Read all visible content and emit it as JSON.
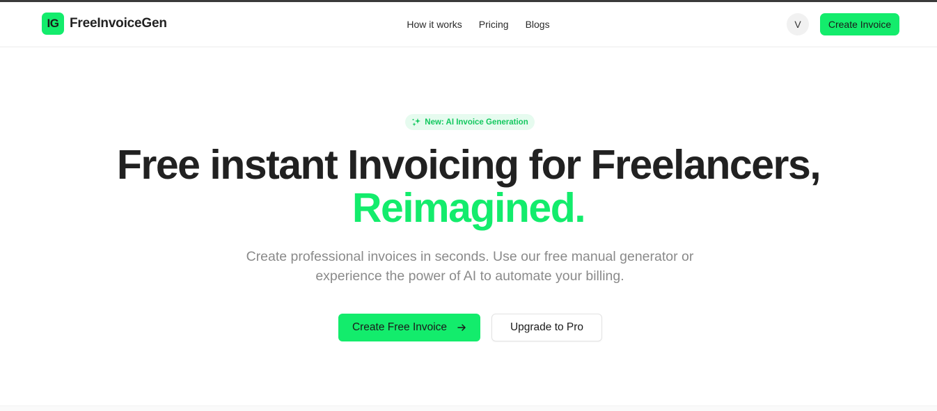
{
  "colors": {
    "accent": "#13ec6c",
    "badge_bg": "#e6fbef",
    "badge_text": "#13c85f",
    "heading": "#212121",
    "muted": "#8a8a8a"
  },
  "header": {
    "logo_text": "IG",
    "brand_name": "FreeInvoiceGen",
    "nav": [
      {
        "label": "How it works"
      },
      {
        "label": "Pricing"
      },
      {
        "label": "Blogs"
      }
    ],
    "avatar_initial": "V",
    "cta_label": "Create Invoice"
  },
  "hero": {
    "badge_icon": "sparkles-icon",
    "badge_text": "New: AI Invoice Generation",
    "title_line1": "Free instant Invoicing for Freelancers,",
    "title_line2": "Reimagined.",
    "subtitle": "Create professional invoices in seconds. Use our free manual generator or experience the power of AI to automate your billing.",
    "primary_button": "Create Free Invoice",
    "primary_icon": "arrow-right-icon",
    "secondary_button": "Upgrade to Pro"
  }
}
